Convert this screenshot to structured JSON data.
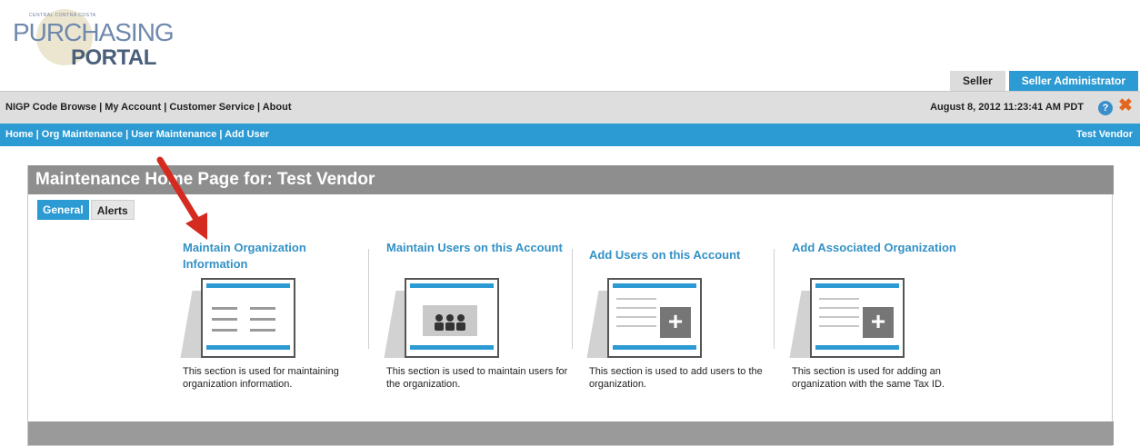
{
  "logo": {
    "small_text": "CENTRAL CONTRA COSTA",
    "line1": "PURCHASING",
    "line2": "PORTAL"
  },
  "role_tabs": {
    "seller": "Seller",
    "seller_admin": "Seller Administrator"
  },
  "topnav": {
    "links": [
      "NIGP Code Browse",
      "My Account",
      "Customer Service",
      "About"
    ],
    "separator": " | ",
    "datetime": "August 8, 2012 11:23:41 AM PDT",
    "help_glyph": "?",
    "close_glyph": "✖"
  },
  "bluenav": {
    "links": [
      "Home",
      "Org Maintenance",
      "User Maintenance",
      "Add User"
    ],
    "separator": " | ",
    "user": "Test Vendor"
  },
  "panel": {
    "title": "Maintenance Home Page for: Test Vendor",
    "tabs": [
      "General",
      "Alerts"
    ]
  },
  "cards": [
    {
      "title": "Maintain Organization Information",
      "description": "This section is used for maintaining organization information.",
      "icon": "form-icon"
    },
    {
      "title": "Maintain Users on this Account",
      "description": "This section is used to maintain users for the organization.",
      "icon": "users-icon"
    },
    {
      "title": "Add Users on this Account",
      "description": "This section is used to add users to the organization.",
      "icon": "add-icon"
    },
    {
      "title": "Add Associated Organization",
      "description": "This section is used for adding an organization with the same Tax ID.",
      "icon": "add-icon"
    }
  ],
  "colors": {
    "accent_blue": "#2c9ad3",
    "link_blue": "#3391c6",
    "header_gray": "#8e8e8e",
    "annotation_red": "#d42a1f"
  }
}
